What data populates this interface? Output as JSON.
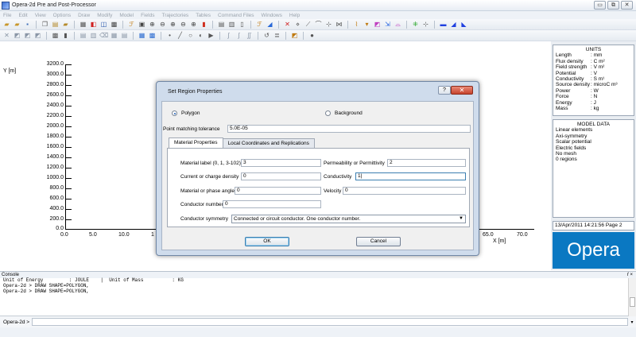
{
  "window": {
    "title": "Opera-2d Pre and Post-Processor",
    "controls": [
      "▭",
      "⧉",
      "✕"
    ]
  },
  "menu": [
    "File",
    "Edit",
    "View",
    "Options",
    "Draw",
    "Modify",
    "Model",
    "Fields",
    "Trajectories",
    "Tables",
    "Command Files",
    "Windows",
    "Help"
  ],
  "graph": {
    "y_label": "Y [m]",
    "y_ticks": [
      "3200.0",
      "3000.0",
      "2800.0",
      "2600.0",
      "2400.0",
      "2200.0",
      "2000.0",
      "1800.0",
      "1600.0",
      "1400.0",
      "1200.0",
      "1000.0",
      "800.0",
      "600.0",
      "400.0",
      "200.0",
      "0.0"
    ],
    "x_ticks_left": [
      "0.0",
      "5.0",
      "10.0",
      "1"
    ],
    "x_ticks_right": [
      "65.0",
      "70.0"
    ],
    "x_label": "X [m]"
  },
  "units": {
    "title": "UNITS",
    "rows": [
      {
        "k": "Length",
        "v": ": mm"
      },
      {
        "k": "Flux density",
        "v": ": C m²"
      },
      {
        "k": "Field strength",
        "v": ": V m²"
      },
      {
        "k": "Potential",
        "v": ": V"
      },
      {
        "k": "Conductivity",
        "v": ": S m¹"
      },
      {
        "k": "Source density",
        "v": ": microC m³"
      },
      {
        "k": "Power",
        "v": ": W"
      },
      {
        "k": "Force",
        "v": ": N"
      },
      {
        "k": "Energy",
        "v": ": J"
      },
      {
        "k": "Mass",
        "v": ": kg"
      }
    ]
  },
  "model_data": {
    "title": "MODEL DATA",
    "lines": [
      "Linear elements",
      "Axi-symmetry",
      "Scalar potential",
      "Electric fields",
      "No mesh",
      "0 regions"
    ]
  },
  "timestamp": "13/Apr/2011 14:21:56 Page 2",
  "logo": "Opera",
  "console": {
    "header": "Console",
    "controls": "ŕ ×",
    "lines": [
      "Unit of Energy         : JOULE    |  Unit of Mass          : KG",
      "",
      "Opera-2d > DRAW SHAPE=POLYGON,",
      "Opera-2d > DRAW SHAPE=POLYGON,"
    ],
    "prompt": "Opera-2d >"
  },
  "dialog": {
    "title": "Set Region Properties",
    "help": "?",
    "close": "✕",
    "radio_polygon": "Polygon",
    "radio_background": "Background",
    "tolerance_label": "Point matching tolerance",
    "tolerance_value": "5.0E-05",
    "tabs": [
      "Material Properties",
      "Local Coordinates and Replications"
    ],
    "fields": {
      "material_label": {
        "label": "Material label (0, 1, 3-102)",
        "value": "3"
      },
      "current_density": {
        "label": "Current or charge density",
        "value": "0"
      },
      "phase_angle": {
        "label": "Material or phase angle",
        "value": "0"
      },
      "conductor_number": {
        "label": "Conductor number",
        "value": "0"
      },
      "permeability": {
        "label": "Permeability or Permittivity",
        "value": "2"
      },
      "conductivity": {
        "label": "Conductivity",
        "value": "1|"
      },
      "velocity": {
        "label": "Velocity",
        "value": "0"
      }
    },
    "symmetry_label": "Conductor symmetry",
    "symmetry_value": "Connected or circuit conductor. One conductor number.",
    "ok": "OK",
    "cancel": "Cancel"
  }
}
